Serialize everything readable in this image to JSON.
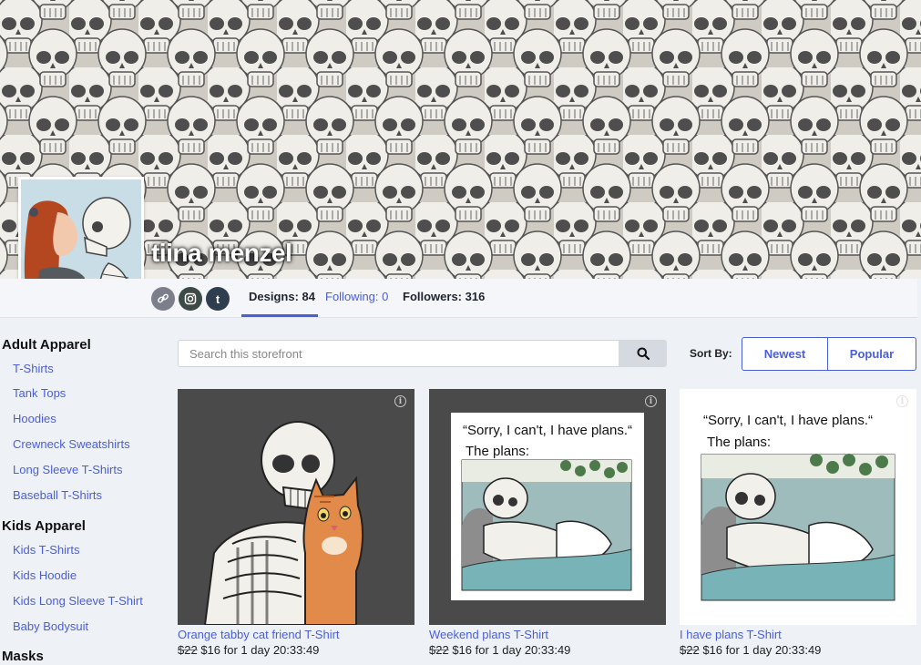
{
  "shop": {
    "name": "tiina menzel"
  },
  "stats": {
    "designs": "Designs: 84",
    "following": "Following: 0",
    "followers": "Followers: 316"
  },
  "social": [
    {
      "name": "link-icon"
    },
    {
      "name": "instagram-icon",
      "glyph": "◎"
    },
    {
      "name": "tumblr-icon",
      "glyph": "t"
    }
  ],
  "sidebar": {
    "sections": [
      {
        "title": "Adult Apparel",
        "items": [
          "T-Shirts",
          "Tank Tops",
          "Hoodies",
          "Crewneck Sweatshirts",
          "Long Sleeve T-Shirts",
          "Baseball T-Shirts"
        ]
      },
      {
        "title": "Kids Apparel",
        "items": [
          "Kids T-Shirts",
          "Kids Hoodie",
          "Kids Long Sleeve T-Shirt",
          "Baby Bodysuit"
        ]
      },
      {
        "title": "Masks",
        "items": []
      }
    ]
  },
  "search": {
    "placeholder": "Search this storefront"
  },
  "sort": {
    "label": "Sort By:",
    "options": [
      "Newest",
      "Popular"
    ]
  },
  "products": [
    {
      "title": "Orange tabby cat friend T-Shirt",
      "old_price": "$22",
      "new_price": " $16 for 1 day 20:33:49",
      "bg": "#4a4a4a"
    },
    {
      "title": "Weekend plans T-Shirt",
      "old_price": "$22",
      "new_price": " $16 for 1 day 20:33:49",
      "bg": "#4a4a4a",
      "meme_line1": "“Sorry, I can't, I have plans.“",
      "meme_line2": "The plans:"
    },
    {
      "title": "I have plans T-Shirt",
      "old_price": "$22",
      "new_price": " $16 for 1 day 20:33:49",
      "bg": "#ffffff",
      "meme_line1": "“Sorry, I can't, I have plans.“",
      "meme_line2": "The plans:"
    }
  ],
  "colors": {
    "accent": "#4a5ed9",
    "page_bg": "#eef1f6",
    "sale_strike": "#dd3333"
  }
}
